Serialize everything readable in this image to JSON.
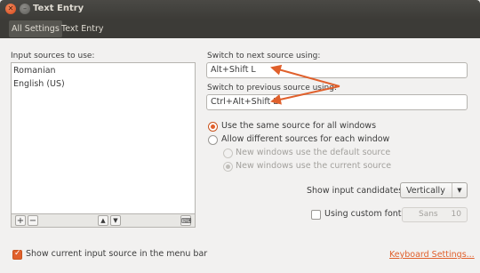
{
  "window": {
    "title": "Text Entry"
  },
  "toolbar": {
    "all_settings": "All Settings",
    "crumb": "Text Entry"
  },
  "left": {
    "sources_label": "Input sources to use:",
    "sources": [
      "Romanian",
      "English (US)"
    ]
  },
  "right": {
    "next_label": "Switch to next source using:",
    "next_value": "Alt+Shift L",
    "prev_label": "Switch to previous source using:",
    "prev_value": "Ctrl+Alt+Shift L",
    "radio_same": "Use the same source for all windows",
    "radio_diff": "Allow different sources for each window",
    "radio_default": "New windows use the default source",
    "radio_current": "New windows use the current source",
    "candidates_label": "Show input candidates:",
    "candidates_value": "Vertically",
    "custom_font_label": "Using custom font:",
    "font_name": "Sans",
    "font_size": "10"
  },
  "footer": {
    "show_source_label": "Show current input source in the menu bar",
    "keyboard_link": "Keyboard Settings..."
  },
  "colors": {
    "accent": "#e0602c",
    "titlebar": "#3c3b37"
  }
}
